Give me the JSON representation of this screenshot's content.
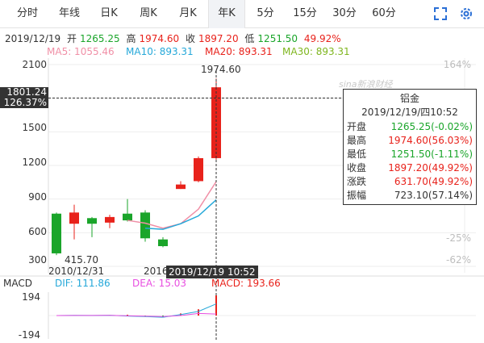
{
  "tabs": [
    {
      "label": "分时"
    },
    {
      "label": "年线"
    },
    {
      "label": "日K"
    },
    {
      "label": "周K"
    },
    {
      "label": "月K"
    },
    {
      "label": "年K",
      "active": true
    },
    {
      "label": "5分"
    },
    {
      "label": "15分"
    },
    {
      "label": "30分"
    },
    {
      "label": "60分"
    }
  ],
  "tools": {
    "expand_icon": "expand-icon",
    "settings_icon": "gear-icon"
  },
  "quote": {
    "date": "2019/12/19",
    "open_label": "开",
    "open": "1265.25",
    "high_label": "高",
    "high": "1974.60",
    "close_label": "收",
    "close": "1897.20",
    "low_label": "低",
    "low": "1251.50",
    "change": "49.92%"
  },
  "ma": {
    "ma5": "MA5: 1055.46",
    "ma10": "MA10: 893.31",
    "ma20": "MA20: 893.31",
    "ma30": "MA30: 893.31"
  },
  "watermark": "sina新浪财经",
  "colors": {
    "up": "#e8221b",
    "down": "#1aa52a",
    "ma5": "#f08fa6",
    "ma10": "#25a8d9",
    "ma20": "#e8221b",
    "ma30": "#7fb61f",
    "pct": "#bdbdbd"
  },
  "crosshair": {
    "price": "1801.24",
    "pct": "126.37%",
    "datetime": "2019/12/19 10:52"
  },
  "tooltip": {
    "name": "铝金",
    "datetime": "2019/12/19/四10:52",
    "rows": [
      {
        "k": "开盘",
        "v": "1265.25(-0.02%)",
        "c": "down"
      },
      {
        "k": "最高",
        "v": "1974.60(56.03%)",
        "c": "up"
      },
      {
        "k": "最低",
        "v": "1251.50(-1.11%)",
        "c": "down"
      },
      {
        "k": "收盘",
        "v": "1897.20(49.92%)",
        "c": "up"
      },
      {
        "k": "涨跌",
        "v": "631.70(49.92%)",
        "c": "up"
      },
      {
        "k": "振幅",
        "v": "723.10(57.14%)",
        "c": "dark"
      }
    ]
  },
  "macd": {
    "label": "MACD",
    "dif": "DIF: 111.86",
    "dea": "DEA: 15.03",
    "macd": "MACD: 193.66",
    "top": "194",
    "bottom": "-194"
  },
  "chart_data": {
    "type": "candlestick",
    "ylim": [
      300,
      2100
    ],
    "yticks": [
      "2100",
      "1800",
      "1500",
      "1200",
      "900",
      "600",
      "300"
    ],
    "pct_ticks": [
      "164%",
      "",
      "",
      "",
      "",
      "-25%",
      "-62%"
    ],
    "x_labels": [
      "2010/12/31",
      "2016"
    ],
    "annotations": {
      "high_label": "1974.60",
      "low_label": "415.70"
    },
    "candles": [
      {
        "o": 770,
        "c": 415.7,
        "h": 780,
        "l": 400
      },
      {
        "o": 680,
        "c": 780,
        "h": 850,
        "l": 540
      },
      {
        "o": 730,
        "c": 680,
        "h": 740,
        "l": 560
      },
      {
        "o": 690,
        "c": 740,
        "h": 760,
        "l": 640
      },
      {
        "o": 770,
        "c": 710,
        "h": 900,
        "l": 700
      },
      {
        "o": 780,
        "c": 550,
        "h": 800,
        "l": 520
      },
      {
        "o": 540,
        "c": 480,
        "h": 560,
        "l": 470
      },
      {
        "o": 990,
        "c": 1030,
        "h": 1060,
        "l": 990
      },
      {
        "o": 1060,
        "c": 1265,
        "h": 1280,
        "l": 1050
      },
      {
        "o": 1265.25,
        "c": 1897.2,
        "h": 1974.6,
        "l": 1251.5
      }
    ],
    "ma5": [
      null,
      null,
      null,
      null,
      710,
      685,
      640,
      680,
      810,
      1055.46
    ],
    "ma10": [
      null,
      null,
      null,
      null,
      null,
      null,
      null,
      null,
      null,
      893.31
    ],
    "ma10_line": [
      null,
      null,
      null,
      null,
      null,
      640,
      630,
      680,
      750,
      893.31
    ],
    "macd_hist": [
      0,
      4,
      3,
      5,
      8,
      -8,
      -14,
      20,
      60,
      193.66
    ],
    "dif": [
      0,
      2,
      1,
      3,
      -5,
      -10,
      -16,
      10,
      40,
      111.86
    ],
    "dea": [
      0,
      1,
      1,
      2,
      -2,
      -6,
      -10,
      0,
      20,
      15.03
    ]
  }
}
